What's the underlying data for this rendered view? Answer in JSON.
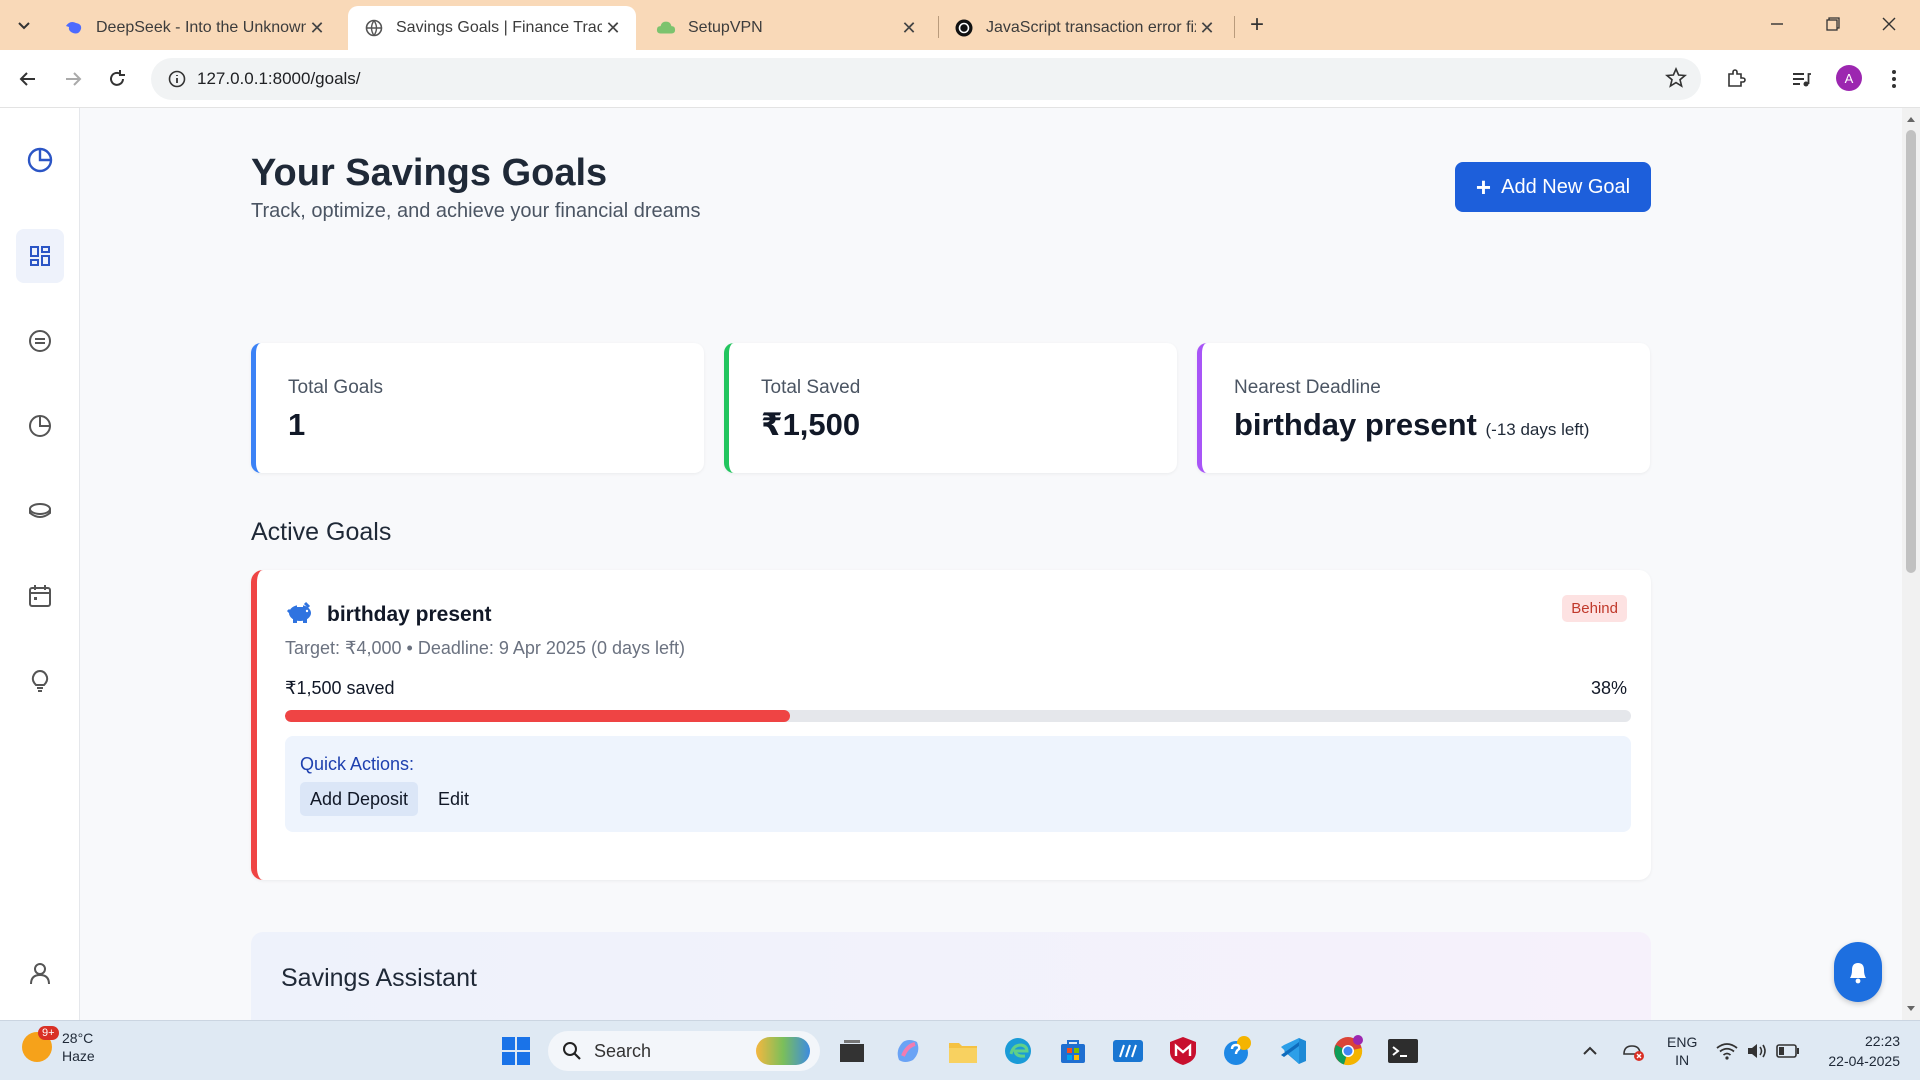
{
  "browser": {
    "tabs": [
      {
        "title": "DeepSeek - Into the Unknown",
        "icon": "deepseek-icon"
      },
      {
        "title": "Savings Goals | Finance Tracker",
        "icon": "globe-icon",
        "active": true
      },
      {
        "title": "SetupVPN",
        "icon": "vpn-cloud-icon"
      },
      {
        "title": "JavaScript transaction error fix",
        "icon": "openai-icon"
      }
    ],
    "url": "127.0.0.1:8000/goals/",
    "profile_initial": "A"
  },
  "page": {
    "title": "Your Savings Goals",
    "subtitle": "Track, optimize, and achieve your financial dreams",
    "add_button": "Add New Goal"
  },
  "stats": [
    {
      "label": "Total Goals",
      "value": "1",
      "accent": "#3b82f6"
    },
    {
      "label": "Total Saved",
      "value": "₹1,500",
      "accent": "#22c55e"
    },
    {
      "label": "Nearest Deadline",
      "value": "birthday present",
      "note": "(-13 days left)",
      "accent": "#a855f7"
    }
  ],
  "active_goals": {
    "heading": "Active Goals",
    "goals": [
      {
        "name": "birthday present",
        "status": "Behind",
        "meta": "Target: ₹4,000 • Deadline: 9 Apr 2025 (0 days left)",
        "saved_label": "₹1,500 saved",
        "percent_label": "38%",
        "progress": 0.375,
        "accent": "#ef4444",
        "quick_actions_label": "Quick Actions:",
        "actions": [
          "Add Deposit",
          "Edit"
        ]
      }
    ]
  },
  "assistant": {
    "title": "Savings Assistant"
  },
  "taskbar": {
    "weather_temp": "28°C",
    "weather_desc": "Haze",
    "weather_badge": "9+",
    "search_placeholder": "Search",
    "lang_top": "ENG",
    "lang_bottom": "IN",
    "time": "22:23",
    "date": "22-04-2025"
  }
}
